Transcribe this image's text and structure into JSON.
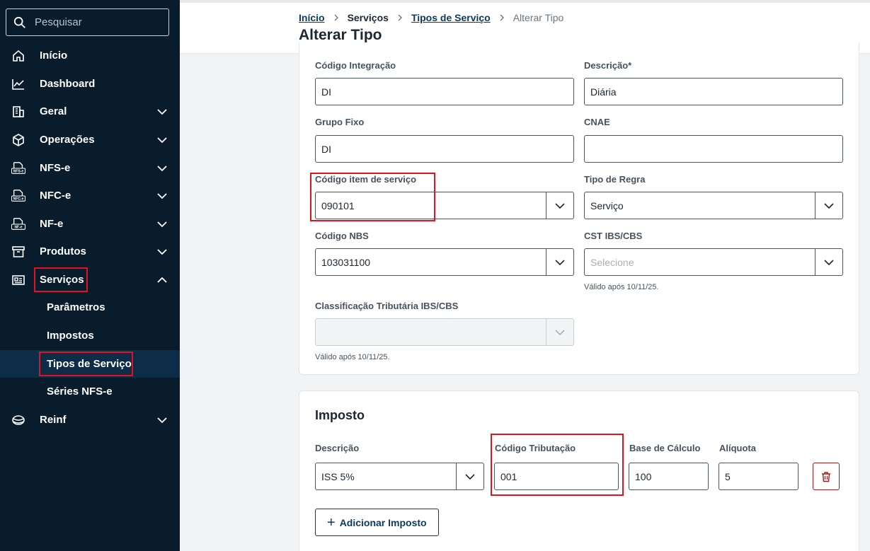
{
  "search": {
    "placeholder": "Pesquisar"
  },
  "sidebar": {
    "items": [
      {
        "label": "Início"
      },
      {
        "label": "Dashboard"
      },
      {
        "label": "Geral"
      },
      {
        "label": "Operações"
      },
      {
        "label": "NFS-e"
      },
      {
        "label": "NFC-e"
      },
      {
        "label": "NF-e"
      },
      {
        "label": "Produtos"
      },
      {
        "label": "Serviços"
      },
      {
        "label": "Reinf"
      }
    ],
    "icon_texts": {
      "nfse": "NFS-e",
      "nfce": "NFC-e",
      "nfe": "NF-e"
    },
    "subitems": [
      {
        "label": "Parâmetros"
      },
      {
        "label": "Impostos"
      },
      {
        "label": "Tipos de Serviço"
      },
      {
        "label": "Séries NFS-e"
      }
    ]
  },
  "breadcrumb": {
    "home": "Início",
    "services": "Serviços",
    "types": "Tipos de Serviço",
    "current": "Alterar Tipo"
  },
  "page": {
    "title": "Alterar Tipo"
  },
  "form": {
    "codigo_integracao": {
      "label": "Código Integração",
      "value": "DI"
    },
    "descricao": {
      "label": "Descrição*",
      "value": "Diária"
    },
    "grupo_fixo": {
      "label": "Grupo Fixo",
      "value": "DI"
    },
    "cnae": {
      "label": "CNAE",
      "value": ""
    },
    "codigo_item": {
      "label": "Código item de serviço",
      "value": "090101"
    },
    "tipo_regra": {
      "label": "Tipo de Regra",
      "value": "Serviço"
    },
    "codigo_nbs": {
      "label": "Código NBS",
      "value": "103031100"
    },
    "cst": {
      "label": "CST IBS/CBS",
      "placeholder": "Selecione",
      "hint": "Válido após 10/11/25."
    },
    "classificacao": {
      "label": "Classificação Tributária IBS/CBS",
      "value": "",
      "hint": "Válido após 10/11/25."
    }
  },
  "imposto": {
    "title": "Imposto",
    "descricao": {
      "label": "Descrição",
      "value": "ISS 5%"
    },
    "codigo_tributacao": {
      "label": "Código Tributação",
      "value": "001"
    },
    "base_calculo": {
      "label": "Base de Cálculo",
      "value": "100"
    },
    "aliquota": {
      "label": "Alíquota",
      "value": "5"
    },
    "add_button": "Adicionar Imposto"
  },
  "colors": {
    "sidebar_bg": "#081c2c",
    "active_item_bg": "#0c2c47",
    "highlight": "#e0141e",
    "link": "#0b3b63",
    "danger": "#a31c1c"
  }
}
